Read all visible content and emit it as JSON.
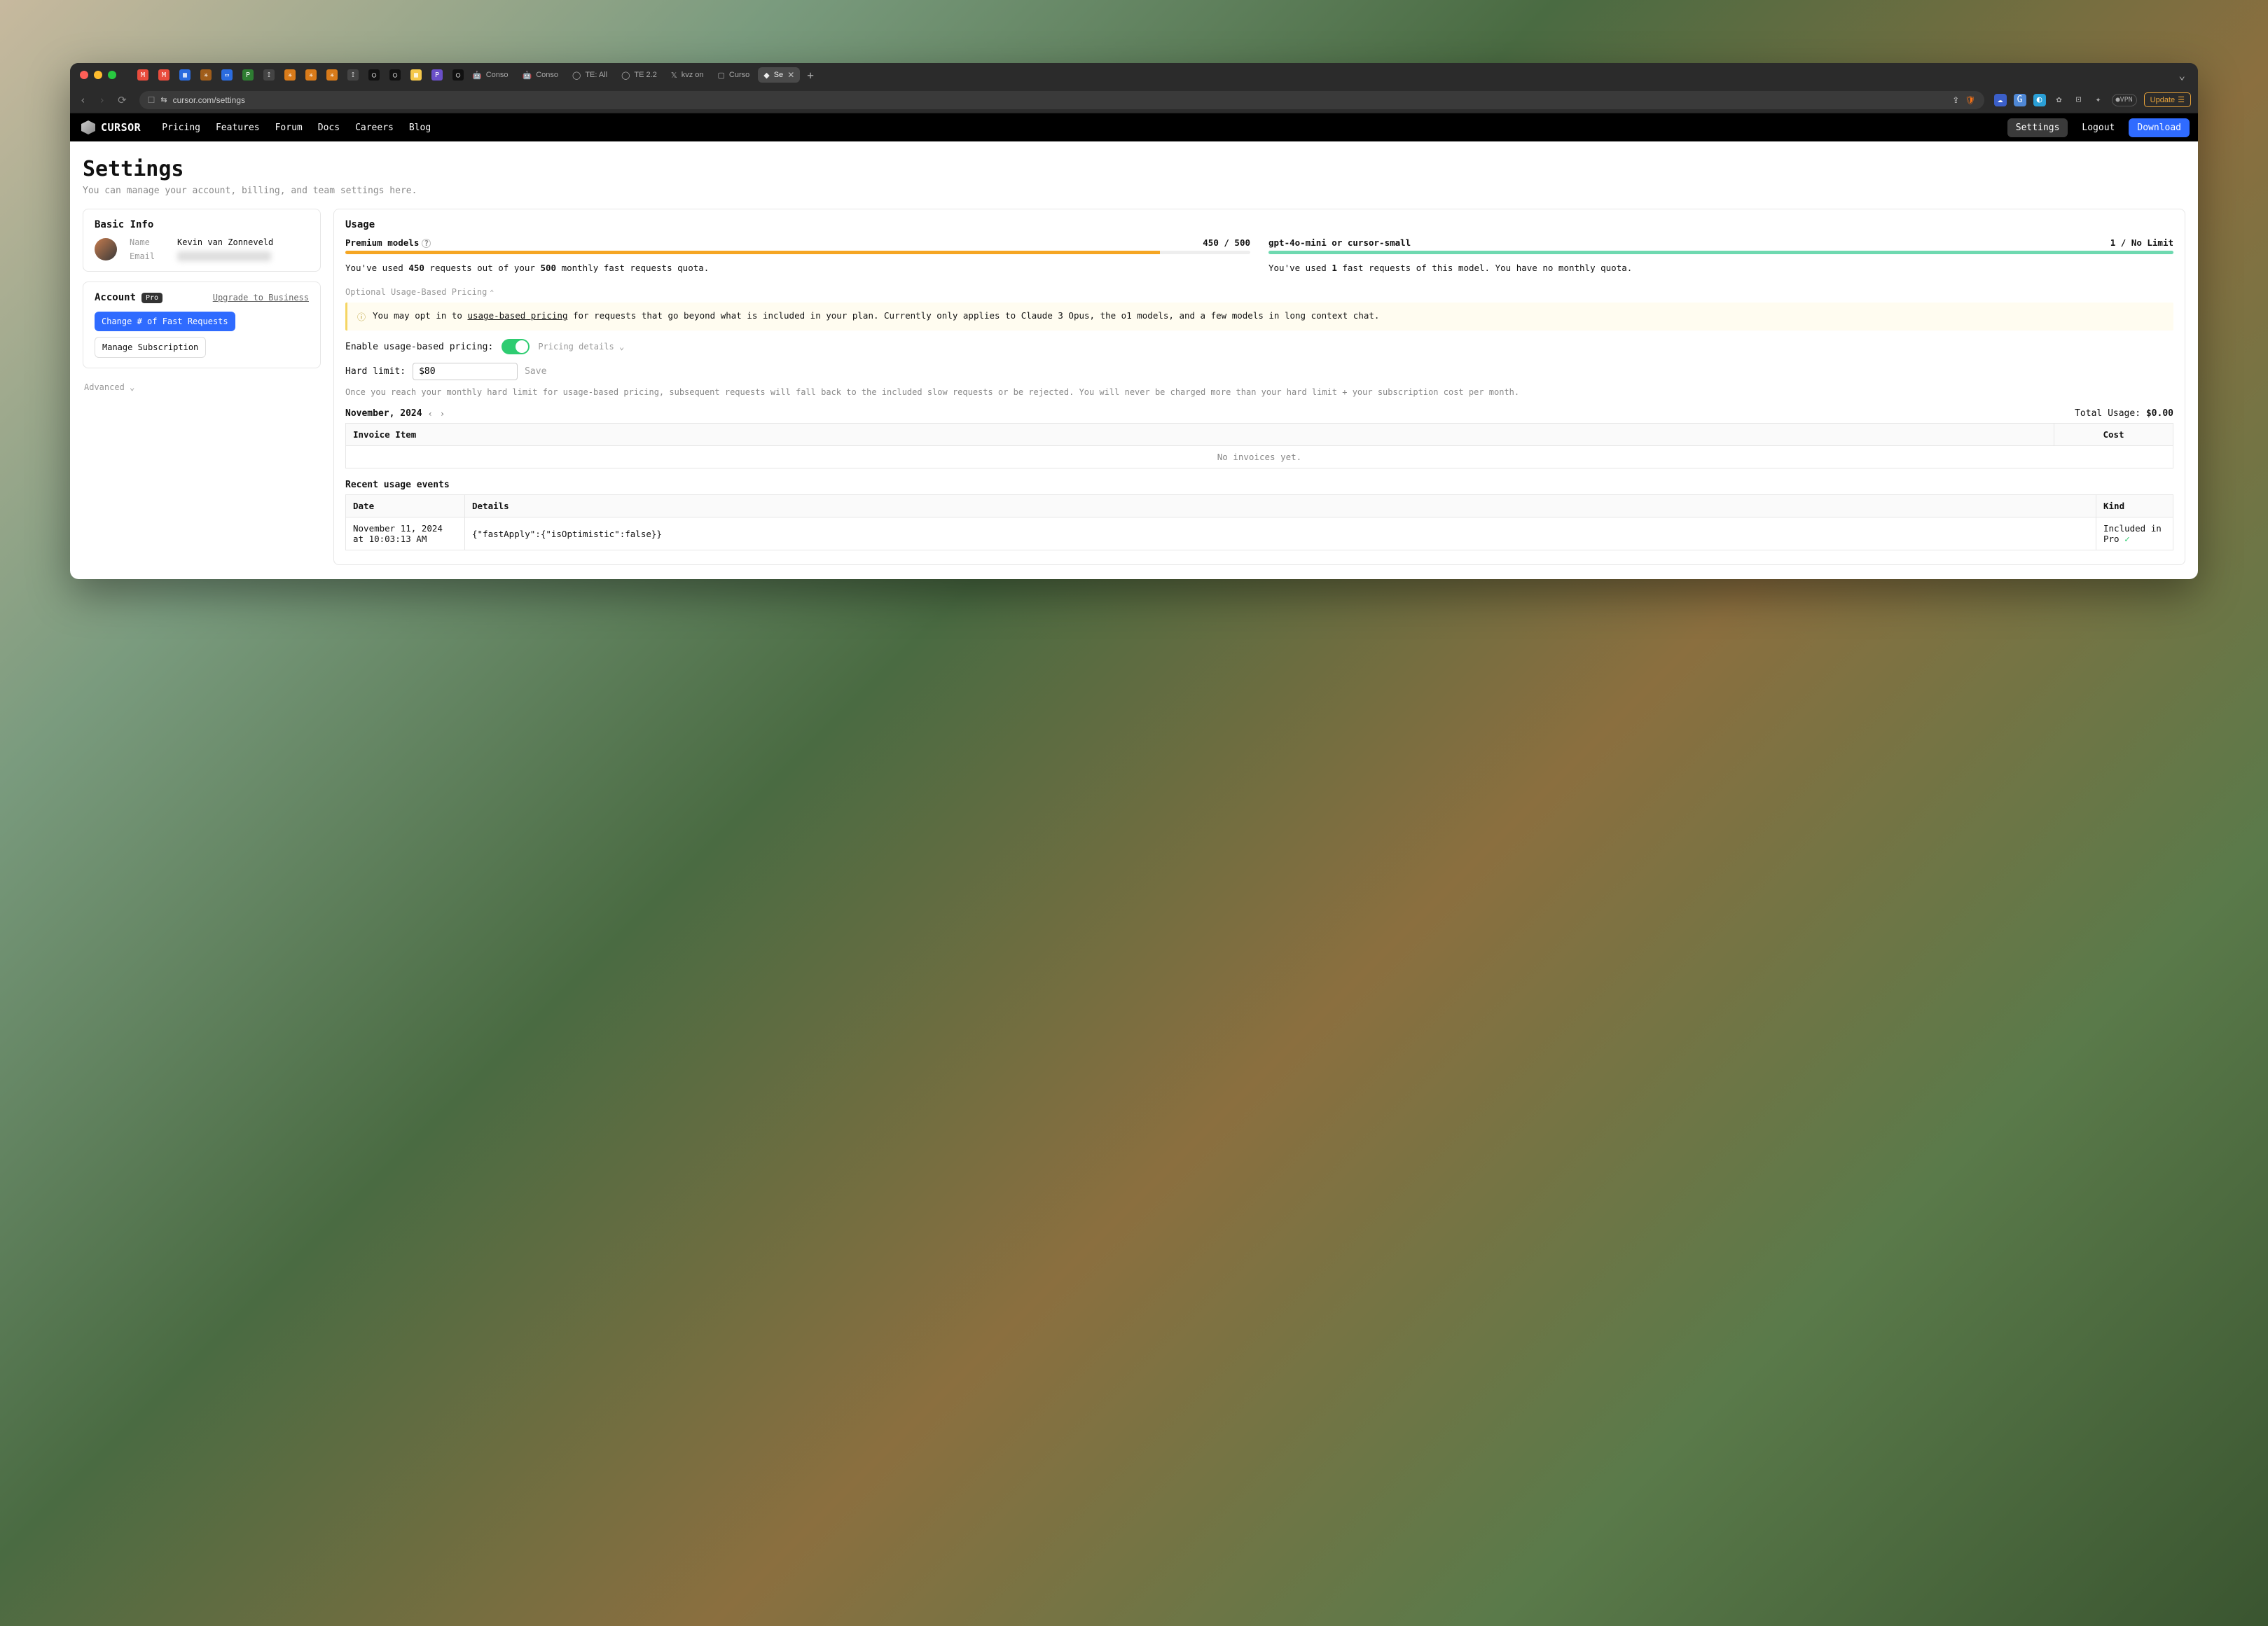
{
  "browser": {
    "url": "cursor.com/settings",
    "update_label": "Update",
    "vpn_label": "VPN",
    "tabs": [
      {
        "label": "Conso"
      },
      {
        "label": "Conso"
      },
      {
        "label": "TE: All"
      },
      {
        "label": "TE 2.2"
      },
      {
        "label": "kvz on"
      },
      {
        "label": "Curso"
      },
      {
        "label": "Se",
        "active": true
      }
    ]
  },
  "header": {
    "brand": "CURSOR",
    "nav": [
      "Pricing",
      "Features",
      "Forum",
      "Docs",
      "Careers",
      "Blog"
    ],
    "settings": "Settings",
    "logout": "Logout",
    "download": "Download"
  },
  "page": {
    "title": "Settings",
    "subtitle": "You can manage your account, billing, and team settings here."
  },
  "basic": {
    "heading": "Basic Info",
    "name_label": "Name",
    "name_value": "Kevin van Zonneveld",
    "email_label": "Email",
    "email_value": "hidden@example.com"
  },
  "account": {
    "heading": "Account",
    "badge": "Pro",
    "upgrade": "Upgrade to Business",
    "change_btn": "Change # of Fast Requests",
    "manage_btn": "Manage Subscription",
    "advanced": "Advanced"
  },
  "usage": {
    "heading": "Usage",
    "premium": {
      "title": "Premium models",
      "count": "450 / 500",
      "pct": 90,
      "t1": "You've used ",
      "b1": "450",
      "t2": " requests out of your ",
      "b2": "500",
      "t3": " monthly fast requests quota."
    },
    "mini": {
      "title": "gpt-4o-mini or cursor-small",
      "count": "1 / No Limit",
      "t1": "You've used ",
      "b1": "1",
      "t2": " fast requests of this model. You have no monthly quota."
    },
    "optional_header": "Optional Usage-Based Pricing",
    "banner_pre": "You may opt in to ",
    "banner_link": "usage-based pricing",
    "banner_post": " for requests that go beyond what is included in your plan. Currently only applies to Claude 3 Opus, the o1 models, and a few models in long context chat.",
    "enable_label": "Enable usage-based pricing:",
    "pricing_details": "Pricing details",
    "hard_limit_label": "Hard limit:",
    "hard_limit_value": "$80",
    "save": "Save",
    "note": "Once you reach your monthly hard limit for usage-based pricing, subsequent requests will fall back to the included slow requests or be rejected. You will never be charged more than your hard limit + your subscription cost per month.",
    "month": "November, 2024",
    "total_label": "Total Usage: ",
    "total_value": "$0.00",
    "th1": "Invoice Item",
    "th2": "Cost",
    "empty": "No invoices yet.",
    "recent_heading": "Recent usage events",
    "rth1": "Date",
    "rth2": "Details",
    "rth3": "Kind",
    "r1_date": "November 11, 2024 at 10:03:13 AM",
    "r1_details": "{\"fastApply\":{\"isOptimistic\":false}}",
    "r1_kind": "Included in Pro"
  }
}
